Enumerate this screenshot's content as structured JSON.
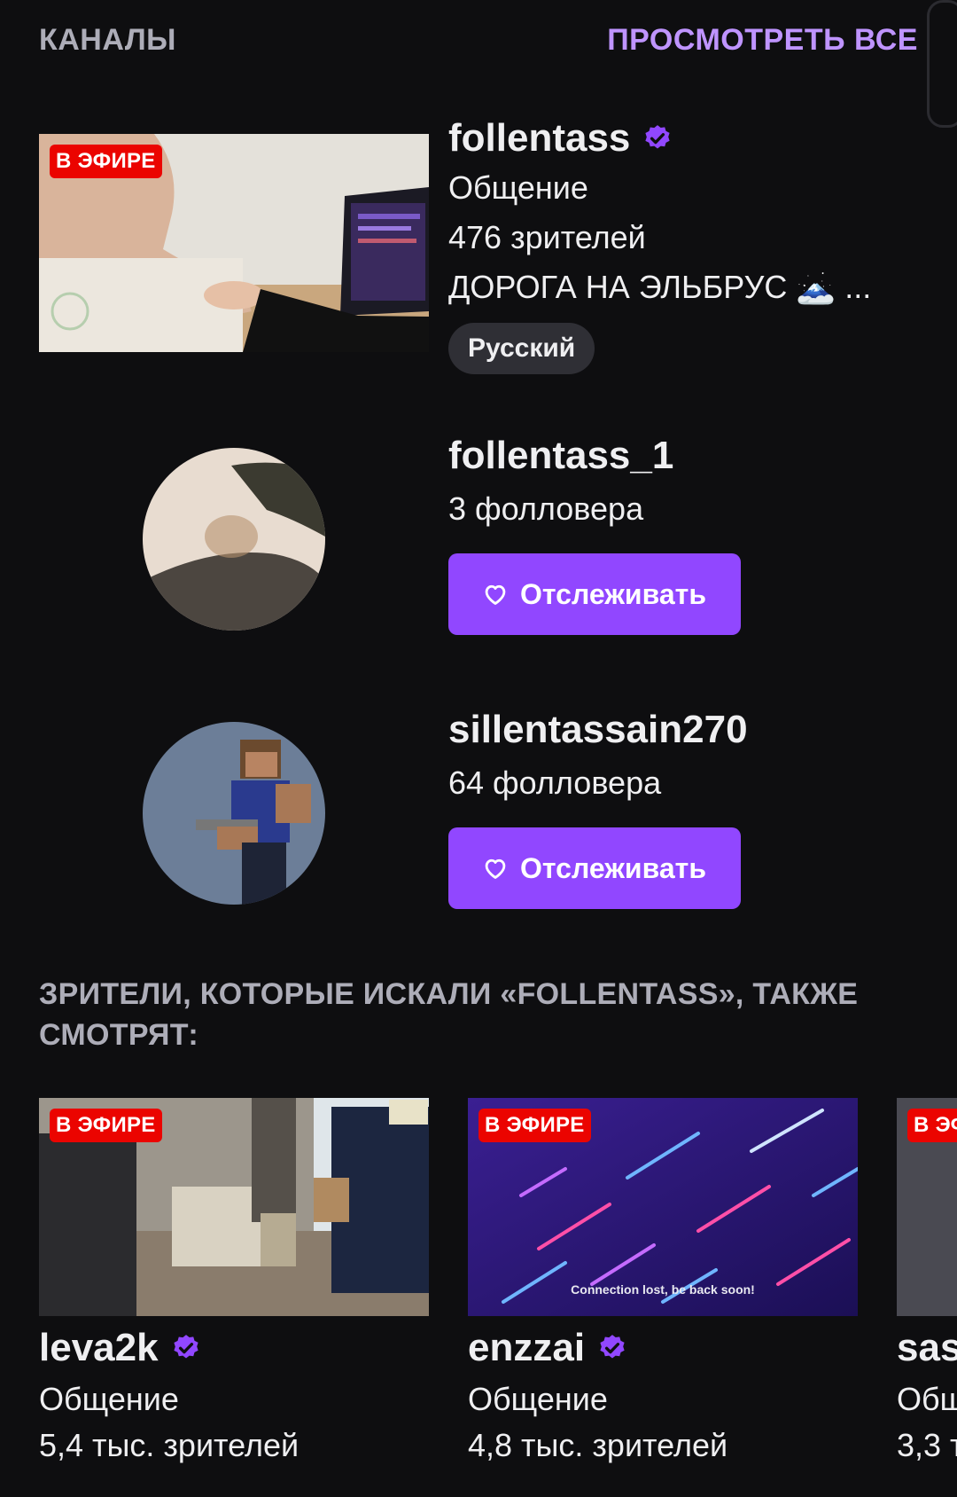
{
  "channels_section": {
    "title": "КАНАЛЫ",
    "see_all": "ПРОСМОТРЕТЬ ВСЕ"
  },
  "live_channel": {
    "badge": "В ЭФИРЕ",
    "name": "follentass",
    "category": "Общение",
    "viewers": "476 зрителей",
    "stream_title": "ДОРОГА НА ЭЛЬБРУС 🗻 ...",
    "tag": "Русский",
    "verified": true
  },
  "offline_channels": [
    {
      "name": "follentass_1",
      "followers": "3 фолловера",
      "follow_label": "Отслеживать"
    },
    {
      "name": "sillentassain270",
      "followers": "64 фолловера",
      "follow_label": "Отслеживать"
    }
  ],
  "related_section": {
    "title": "ЗРИТЕЛИ, КОТОРЫЕ ИСКАЛИ «FOLLENTASS», ТАКЖЕ СМОТРЯТ:"
  },
  "related_channels": [
    {
      "badge": "В ЭФИРЕ",
      "name": "leva2k",
      "category": "Общение",
      "viewers": "5,4 тыс. зрителей",
      "verified": true
    },
    {
      "badge": "В ЭФИРЕ",
      "name": "enzzai",
      "category": "Общение",
      "viewers": "4,8 тыс. зрителей",
      "verified": true,
      "overlay_text": "Connection lost, be back soon!"
    },
    {
      "badge": "В ЭФИРЕ",
      "name": "sas",
      "category": "Общ",
      "viewers": "3,3 т"
    }
  ],
  "colors": {
    "background": "#0e0e10",
    "accent": "#9147ff",
    "accent_text": "#bf94ff",
    "live_red": "#eb0400",
    "muted_text": "#adadb8"
  }
}
